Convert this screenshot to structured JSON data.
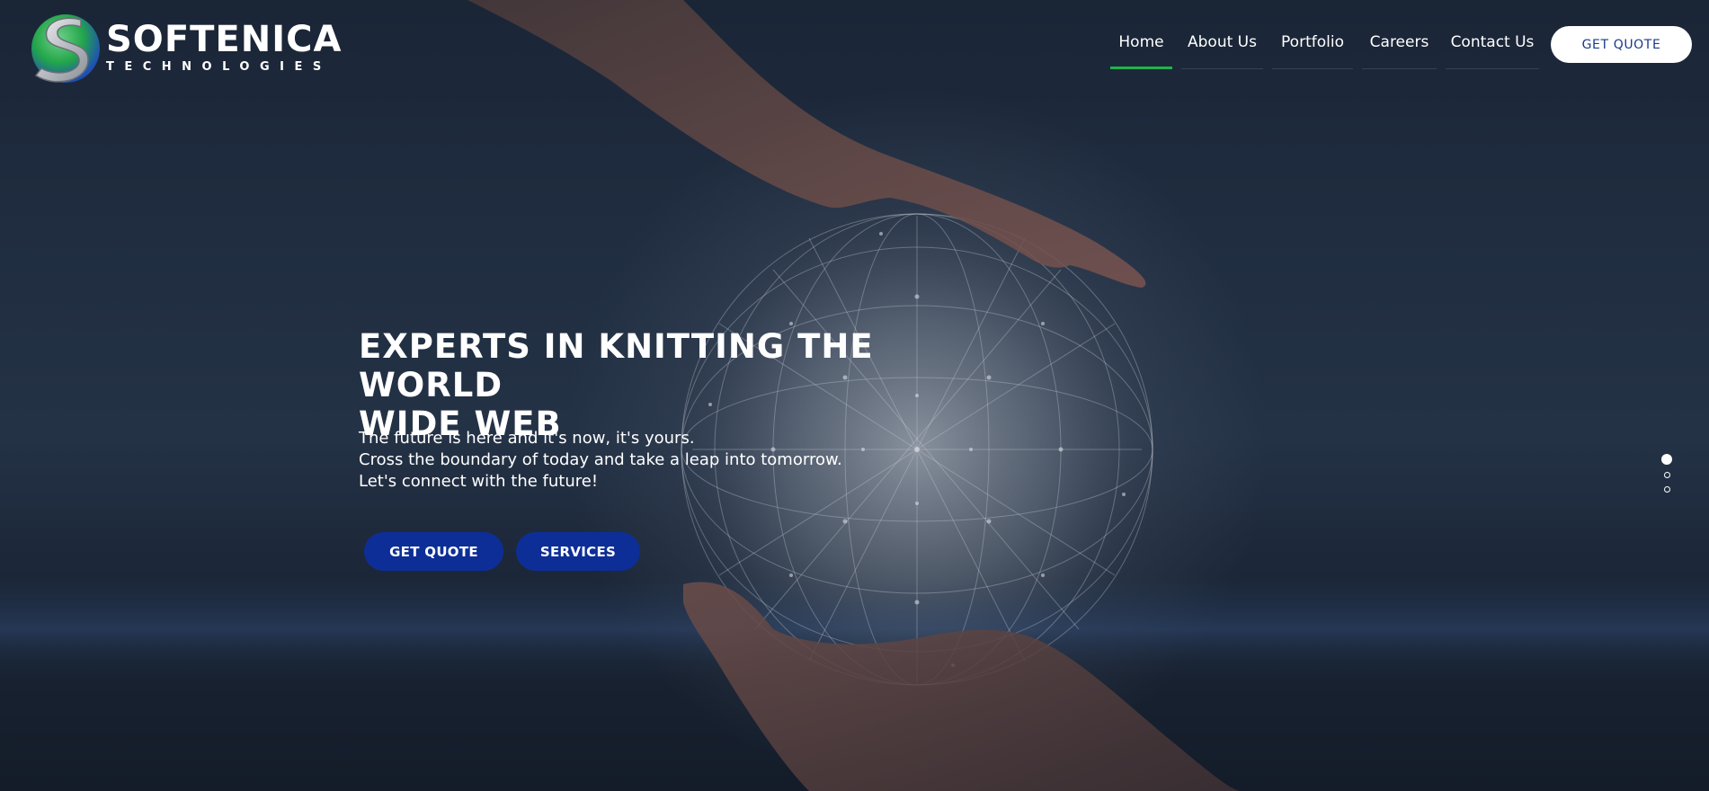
{
  "brand": {
    "name": "SOFTENICA",
    "tagline": "TECHNOLOGIES"
  },
  "nav": {
    "items": [
      {
        "label": "Home",
        "active": true
      },
      {
        "label": "About Us",
        "active": false
      },
      {
        "label": "Portfolio",
        "active": false
      },
      {
        "label": "Careers",
        "active": false
      },
      {
        "label": "Contact Us",
        "active": false
      }
    ],
    "quote_button": "GET QUOTE"
  },
  "hero": {
    "title_line1": "EXPERTS IN KNITTING THE WORLD",
    "title_line2": "WIDE WEB",
    "lines": [
      "The future is here and it's now, it's yours.",
      "Cross the boundary of today and take a leap into tomorrow.",
      "Let's connect with the future!"
    ],
    "buttons": {
      "primary": "GET QUOTE",
      "secondary": "SERVICES"
    }
  },
  "slider": {
    "slide_count": 3,
    "active_index": 0
  },
  "colors": {
    "nav_active_underline": "#21b24a",
    "button_blue": "#0d2e96",
    "quote_text": "#1a3a8a",
    "background_dark": "#1f2c3f"
  },
  "icons": {
    "logo": "globe-s-logo-icon"
  }
}
